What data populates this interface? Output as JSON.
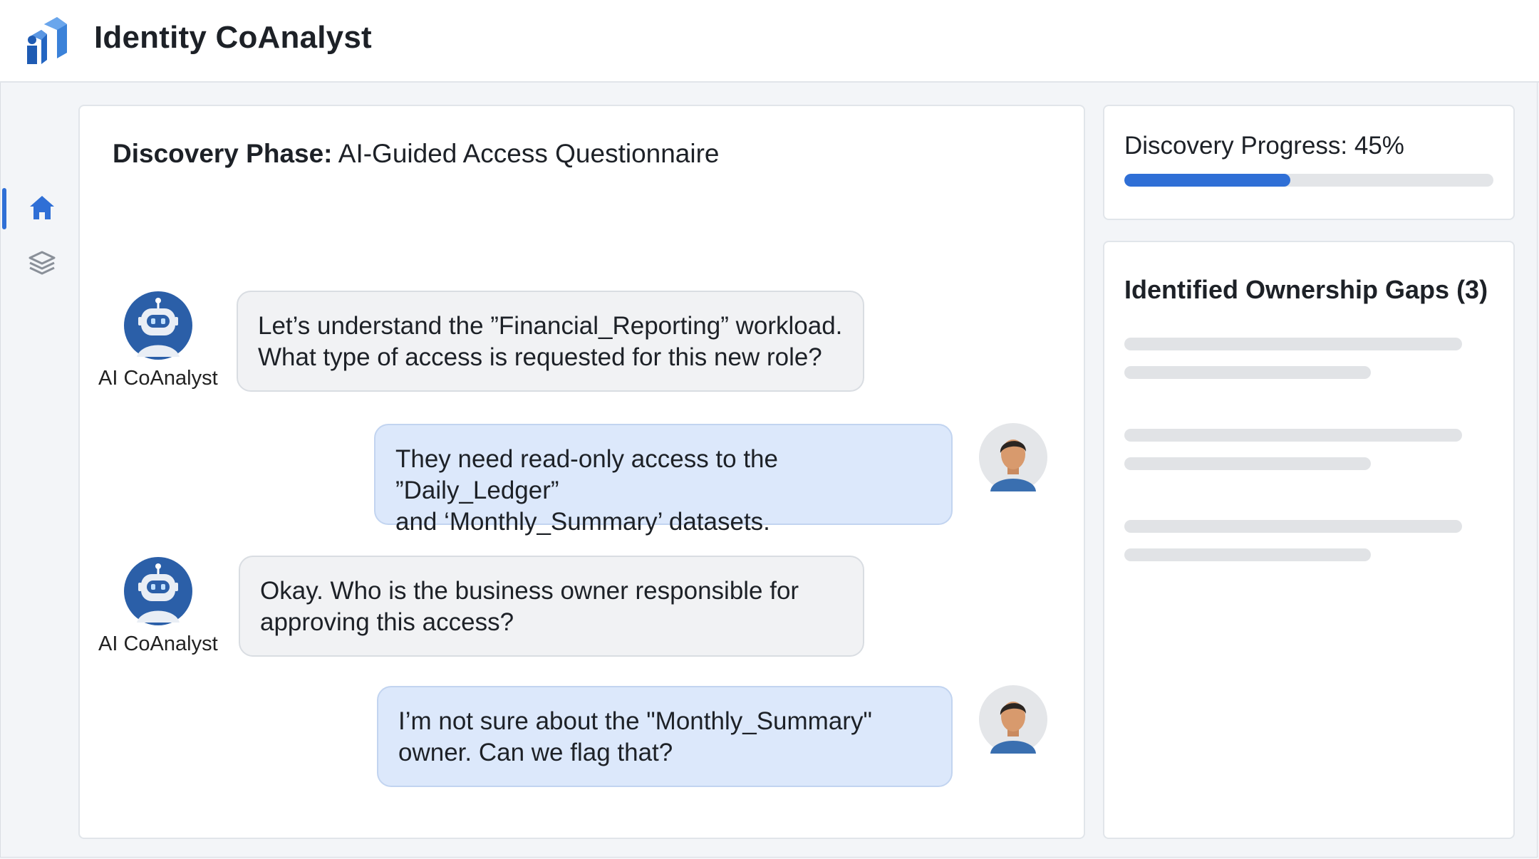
{
  "app": {
    "title": "Identity CoAnalyst",
    "logo_icon": "bar-chart-logo-icon",
    "accent_color": "#2f6fd6"
  },
  "sidebar": {
    "items": [
      {
        "icon": "home-icon",
        "active": true
      },
      {
        "icon": "layers-icon",
        "active": false
      }
    ]
  },
  "chat": {
    "heading_bold": "Discovery Phase:",
    "heading_rest": "AI-Guided Access Questionnaire",
    "messages": [
      {
        "sender": "ai",
        "sender_label": "AI CoAnalyst",
        "line1": "Let’s understand the ”Financial_Reporting” workload.",
        "line2": "What type of access is requested for this new role?"
      },
      {
        "sender": "user",
        "line1": "They need read-only access to the ”Daily_Ledger”",
        "line2": "and ‘Monthly_Summary’ datasets."
      },
      {
        "sender": "ai",
        "sender_label": "AI CoAnalyst",
        "line1": "Okay. Who is the business owner responsible for",
        "line2": "approving this access?"
      },
      {
        "sender": "user",
        "line1": "I’m not sure about the \"Monthly_Summary\"",
        "line2": "owner. Can we flag that?"
      }
    ]
  },
  "progress": {
    "label": "Discovery Progress: 45%",
    "value": 0.45
  },
  "gaps": {
    "title": "Identified Ownership Gaps (3)"
  }
}
